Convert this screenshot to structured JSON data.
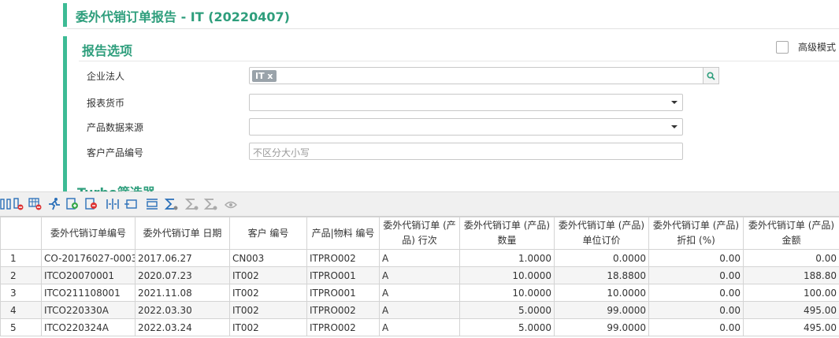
{
  "page": {
    "title": "委外代销订单报告 - IT (20220407)"
  },
  "options": {
    "section_title": "报告选项",
    "advanced_mode_label": "高级模式",
    "fields": {
      "company_label": "企业法人",
      "company_tag": "IT x",
      "currency_label": "报表货币",
      "currency_value": "",
      "source_label": "产品数据来源",
      "source_value": "",
      "customer_code_label": "客户产品编号",
      "customer_code_placeholder": "不区分大小写"
    }
  },
  "turbo": {
    "title": "Turbo筛选器"
  },
  "toolbar": {
    "icons": [
      "columns-icon",
      "remove-column-icon",
      "grid-remove-icon",
      "run-icon",
      "add-icon",
      "delete-icon",
      "split-icon",
      "fit-icon",
      "merge-icon",
      "sum-icon",
      "subtotal-icon",
      "sum-remove-icon",
      "preview-icon"
    ]
  },
  "table": {
    "headers": [
      "",
      "委外代销订单编号",
      "委外代销订单 日期",
      "客户 编号",
      "产品|物料 编号",
      "委外代销订单 (产品) 行次",
      "委外代销订单 (产品) 数量",
      "委外代销订单 (产品) 单位订价",
      "委外代销订单 (产品) 折扣 (%)",
      "委外代销订单 (产品) 金额"
    ],
    "rows": [
      [
        "1",
        "CO-20176027-0003",
        "2017.06.27",
        "CN003",
        "ITPRO002",
        "A",
        "1.0000",
        "0.0000",
        "0.00",
        "0.00"
      ],
      [
        "2",
        "ITCO20070001",
        "2020.07.23",
        "IT002",
        "ITPRO001",
        "A",
        "10.0000",
        "18.8800",
        "0.00",
        "188.80"
      ],
      [
        "3",
        "ITCO211108001",
        "2021.11.08",
        "IT002",
        "ITPRO001",
        "A",
        "10.0000",
        "10.0000",
        "0.00",
        "100.00"
      ],
      [
        "4",
        "ITCO220330A",
        "2022.03.30",
        "IT002",
        "ITPRO002",
        "A",
        "5.0000",
        "99.0000",
        "0.00",
        "495.00"
      ],
      [
        "5",
        "ITCO220324A",
        "2022.03.24",
        "IT002",
        "ITPRO002",
        "A",
        "5.0000",
        "99.0000",
        "0.00",
        "495.00"
      ]
    ]
  }
}
